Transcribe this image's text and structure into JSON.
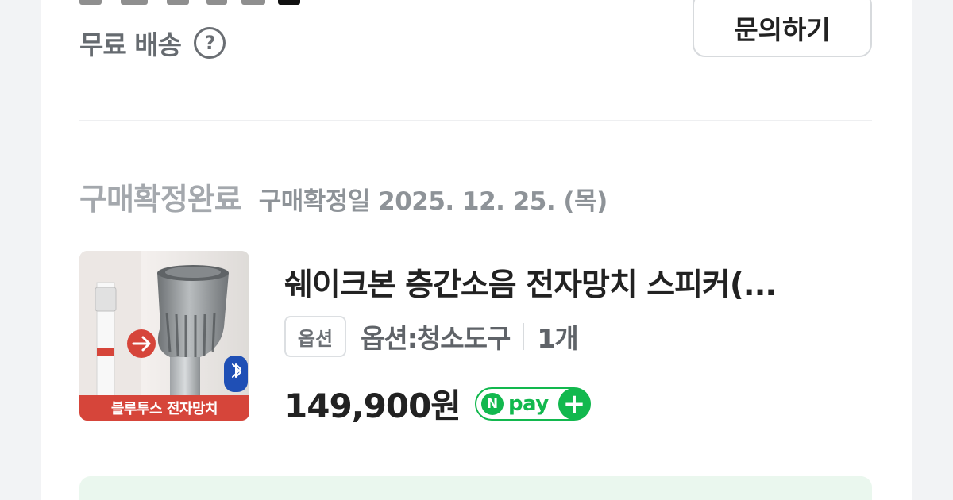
{
  "shipping": {
    "label": "무료 배송",
    "help_icon": "question-circle-icon"
  },
  "inquiry_button": {
    "label": "문의하기"
  },
  "order_status": {
    "title": "구매확정완료",
    "date_text": "구매확정일 2025. 12. 25. (목)"
  },
  "product": {
    "image_caption": "블루투스 전자망치",
    "title": "쉐이크본 층간소음 전자망치 스피커(...",
    "option_badge": "옵션",
    "option_text": "옵션:청소도구",
    "quantity": "1개",
    "price": "149,900원"
  },
  "npay": {
    "label": "pay",
    "n_label": "N",
    "plus_label": "+",
    "brand_color": "#12b84e"
  }
}
